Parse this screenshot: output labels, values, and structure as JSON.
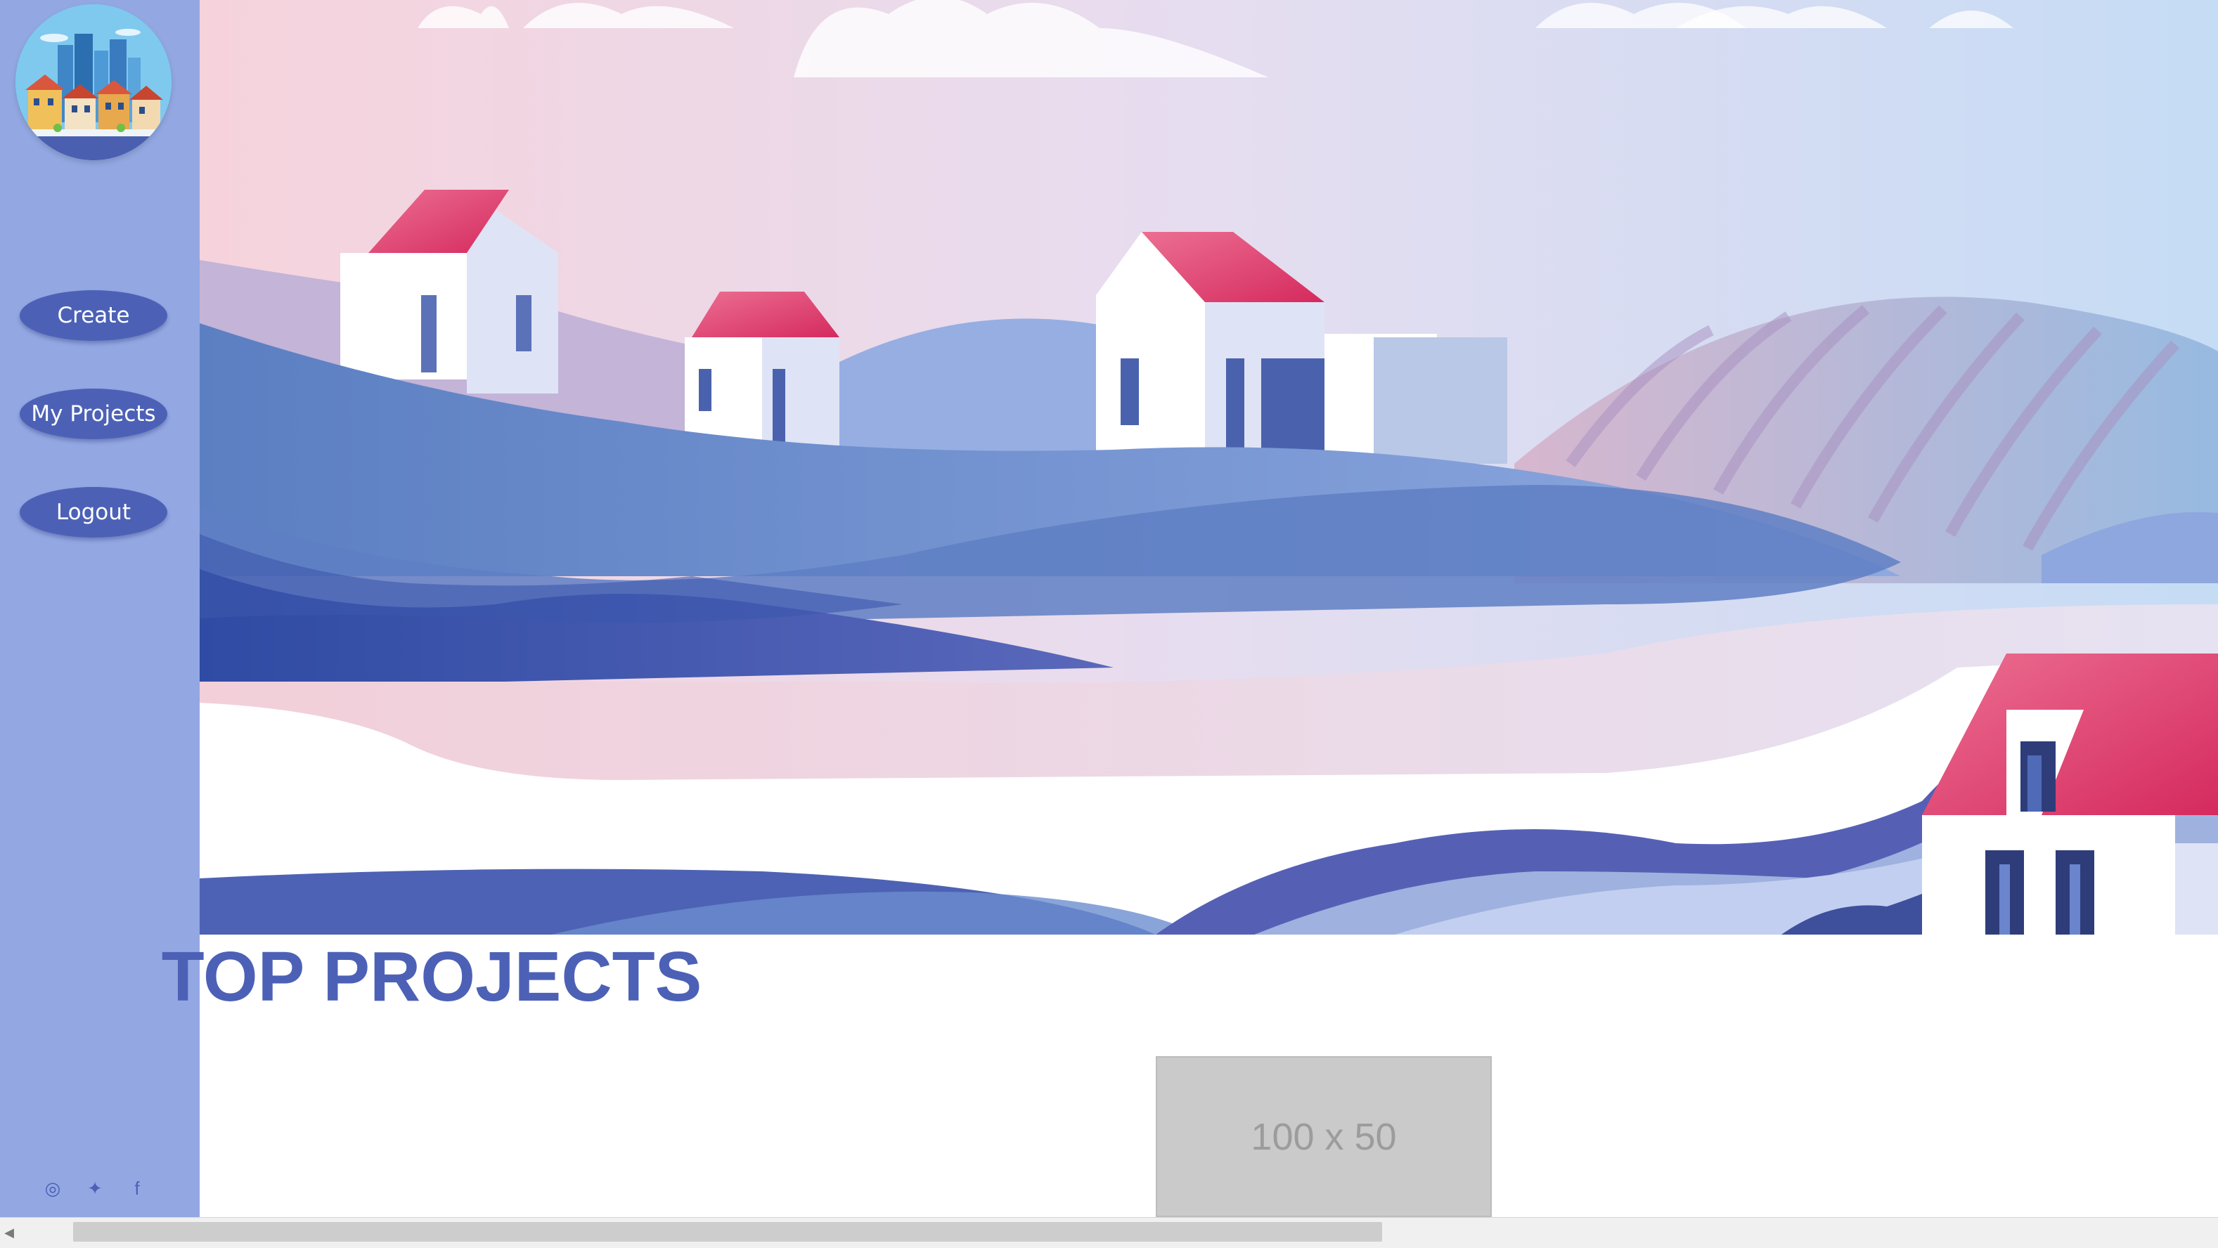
{
  "sidebar": {
    "logo_name": "city-logo",
    "nav": [
      {
        "label": "Create"
      },
      {
        "label": "My Projects"
      },
      {
        "label": "Logout"
      }
    ],
    "social": [
      {
        "icon": "instagram-icon",
        "glyph": "◎"
      },
      {
        "icon": "twitter-icon",
        "glyph": "✦"
      },
      {
        "icon": "facebook-icon",
        "glyph": "f"
      }
    ]
  },
  "main": {
    "section_title": "TOP PROJECTS",
    "placeholder_text": "100 x 50"
  },
  "colors": {
    "sidebar_bg": "#93a8e3",
    "accent": "#4c61b6",
    "roof": "#e0456f"
  }
}
